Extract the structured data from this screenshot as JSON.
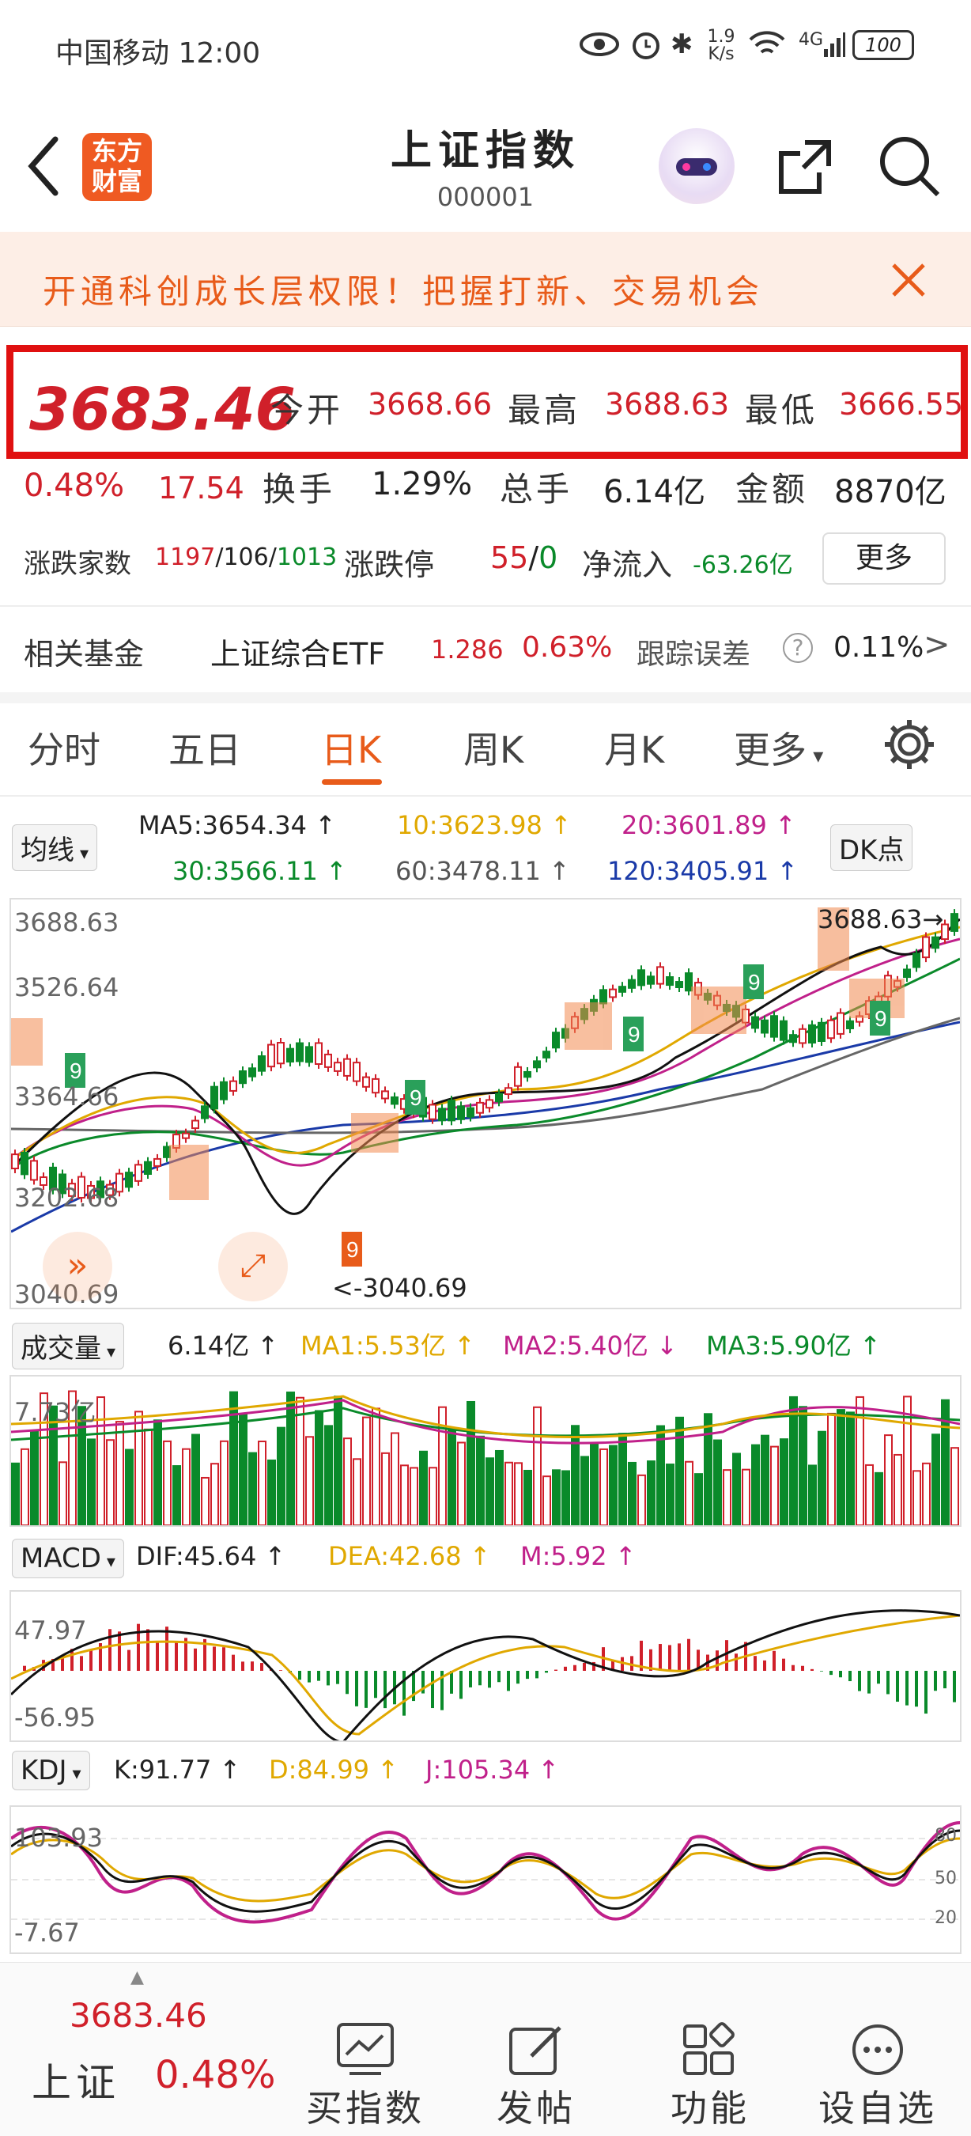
{
  "status_bar": {
    "carrier": "中国移动 12:00",
    "speed": "1.9 K/s",
    "network": "4G",
    "battery": "100"
  },
  "header": {
    "title": "上证指数",
    "code": "000001",
    "logo_line1": "东方",
    "logo_line2": "财富"
  },
  "banner": {
    "text": "开通科创成长层权限！把握打新、交易机会"
  },
  "quote": {
    "price": "3683.46",
    "open_label": "今开",
    "open": "3668.66",
    "high_label": "最高",
    "high": "3688.63",
    "low_label": "最低",
    "low": "3666.55",
    "change_pct": "0.48%",
    "change": "17.54",
    "turnover_label": "换手",
    "turnover": "1.29%",
    "volume_label": "总手",
    "volume": "6.14亿",
    "amount_label": "金额",
    "amount": "8870亿",
    "breadth_label": "涨跌家数",
    "up": "1197",
    "flat": "106",
    "down": "1013",
    "limit_label": "涨跌停",
    "limit_up": "55",
    "limit_down": "0",
    "inflow_label": "净流入",
    "inflow": "-63.26亿",
    "more": "更多"
  },
  "fund": {
    "label": "相关基金",
    "name": "上证综合ETF",
    "price": "1.286",
    "pct": "0.63%",
    "err_label": "跟踪误差",
    "err": "0.11%"
  },
  "tabs": [
    "分时",
    "五日",
    "日K",
    "周K",
    "月K",
    "更多"
  ],
  "ma": {
    "chip": "均线",
    "ma5": "MA5:3654.34 ↑",
    "ma10": "10:3623.98 ↑",
    "ma20": "20:3601.89 ↑",
    "ma30": "30:3566.11 ↑",
    "ma60": "60:3478.11 ↑",
    "ma120": "120:3405.91 ↑",
    "dk": "DK点"
  },
  "kline": {
    "y_top": "3688.63",
    "y2": "3526.64",
    "y3": "3364.66",
    "y4": "3202.68",
    "y_bottom": "3040.69",
    "high_mark": "3688.63",
    "low_mark": "3040.69"
  },
  "vol": {
    "chip": "成交量",
    "value": "6.14亿 ↑",
    "ma1": "MA1:5.53亿 ↑",
    "ma2": "MA2:5.40亿 ↓",
    "ma3": "MA3:5.90亿 ↑",
    "y_top": "7.73亿"
  },
  "macd": {
    "chip": "MACD",
    "dif": "DIF:45.64 ↑",
    "dea": "DEA:42.68 ↑",
    "m": "M:5.92 ↑",
    "y_top": "47.97",
    "y_bottom": "-56.95"
  },
  "kdj": {
    "chip": "KDJ",
    "k": "K:91.77 ↑",
    "d": "D:84.99 ↑",
    "j": "J:105.34 ↑",
    "y_top": "103.93",
    "y_bottom": "-7.67",
    "r80": "80",
    "r50": "50",
    "r20": "20"
  },
  "bottom": {
    "price": "3683.46",
    "name": "上证",
    "pct": "0.48%",
    "buy": "买指数",
    "post": "发帖",
    "func": "功能",
    "fav": "设自选"
  },
  "colors": {
    "up": "#d0202a",
    "down": "#0a8a2a",
    "accent": "#e85b1a"
  }
}
